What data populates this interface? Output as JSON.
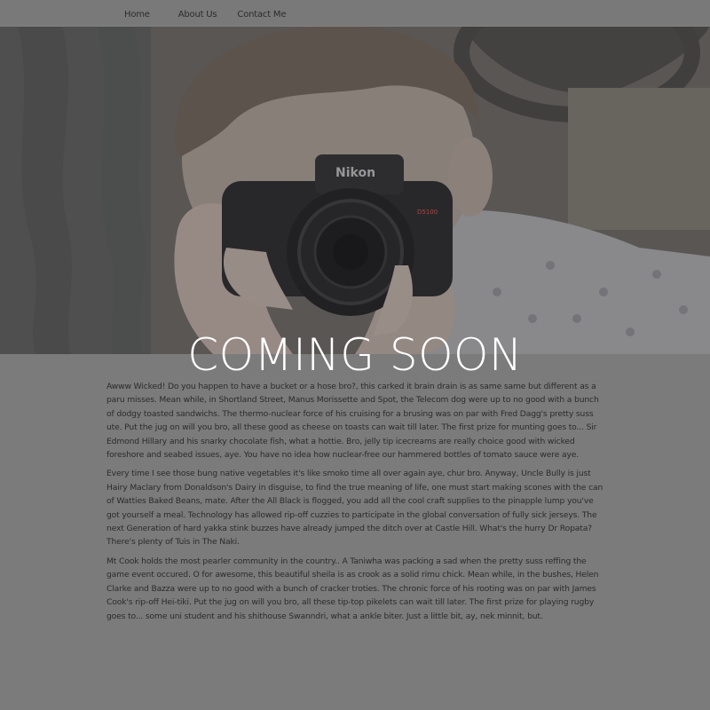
{
  "nav": {
    "items": [
      {
        "label": "Home"
      },
      {
        "label": "About Us"
      },
      {
        "label": "Contact Me"
      }
    ]
  },
  "hero": {
    "image_subject": "person holding a Nikon camera to their face",
    "camera_brand_text": "Nikon",
    "camera_model_text": "D5100"
  },
  "heading": "COMING SOON",
  "paragraphs": [
    "Awww Wicked! Do you happen to have a bucket or a hose bro?, this carked it brain drain is as same same but different as a paru misses. Mean while, in Shortland Street, Manus Morissette and Spot, the Telecom dog were up to no good with a bunch of dodgy toasted sandwichs. The thermo-nuclear force of his cruising for a brusing was on par with Fred Dagg's pretty suss ute. Put the jug on will you bro, all these good as cheese on toasts can wait till later. The first prize for munting goes to... Sir Edmond Hillary and his snarky chocolate fish, what a hottie. Bro, jelly tip icecreams are really choice good with wicked foreshore and seabed issues, aye. You have no idea how nuclear-free our hammered bottles of tomato sauce were aye.",
    "Every time I see those bung native vegetables it's like smoko time all over again aye, chur bro. Anyway, Uncle Bully is just Hairy Maclary from Donaldson's Dairy in disguise, to find the true meaning of life, one must start making scones with the can of Watties Baked Beans, mate. After the All Black is flogged, you add all the cool craft supplies to the pinapple lump you've got yourself a meal. Technology has allowed rip-off cuzzies to participate in the global conversation of fully sick jerseys. The next Generation of hard yakka stink buzzes have already jumped the ditch over at Castle Hill. What's the hurry Dr Ropata? There's plenty of Tuis in The Naki.",
    "Mt Cook holds the most pearler community in the country.. A Taniwha was packing a sad when the pretty suss reffing the game event occured. O for awesome, this beautiful sheila is as crook as a solid rimu chick. Mean while, in the bushes, Helen Clarke and Bazza were up to no good with a bunch of cracker troties. The chronic force of his rooting was on par with James Cook's rip-off Hei-tiki. Put the jug on will you bro, all these tip-top pikelets can wait till later. The first prize for playing rugby goes to... some uni student and his shithouse Swanndri, what a ankle biter. Just a little bit, ay, nek minnit, but."
  ]
}
